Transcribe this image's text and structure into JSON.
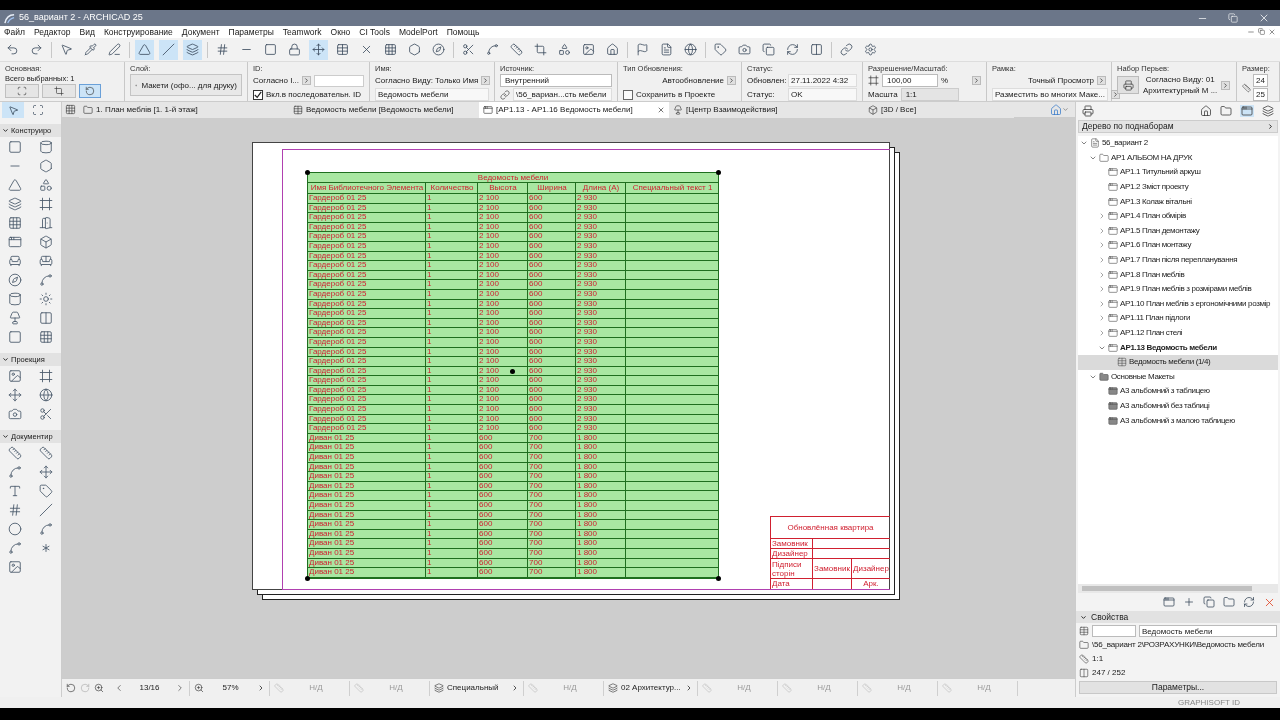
{
  "window": {
    "title": "56_вариант 2 - ARCHICAD 25"
  },
  "menu": [
    "Файл",
    "Редактор",
    "Вид",
    "Конструирование",
    "Документ",
    "Параметры",
    "Teamwork",
    "Окно",
    "CI Tools",
    "ModelPort",
    "Помощь"
  ],
  "info_box": [
    {
      "kind": "basic",
      "label": "Основная:",
      "text": "Всего выбранных: 1"
    },
    {
      "kind": "layer",
      "label": "Слой:",
      "value": "Макети (офо... для друку)"
    },
    {
      "kind": "id",
      "label": "ID:",
      "value": "Согласно I...",
      "checkbox": {
        "label": "Вкл.в последовательн. ID",
        "checked": true
      }
    },
    {
      "kind": "name",
      "label": "Имя:",
      "value": "Согласно Виду: Только Имя",
      "value2": "Ведомость мебели"
    },
    {
      "kind": "source",
      "label": "Источник:",
      "value": "Внутренний",
      "value2": "\\56_вариан...сть мебели"
    },
    {
      "kind": "update",
      "label": "Тип Обновления:",
      "value": "Автообновление",
      "checkbox": {
        "label": "Сохранить в Проекте",
        "checked": false
      }
    },
    {
      "kind": "status",
      "label": "Статус:",
      "rows": [
        {
          "label": "Обновлен:",
          "value": "27.11.2022 4:32"
        },
        {
          "label": "Статус:",
          "value": "OK"
        }
      ]
    },
    {
      "kind": "scale",
      "label": "Разрешение/Масштаб:",
      "value": "100,00",
      "unit": "%",
      "row_label": "Масшта",
      "value2": "1:1"
    },
    {
      "kind": "frame",
      "label": "Рамка:",
      "value": "Точный Просмотр",
      "value2": "Разместить во многих Маке..."
    },
    {
      "kind": "pens",
      "label": "Набор Перьев:",
      "value": "Согласно Виду: 01",
      "value2": "Архитектурный М ..."
    },
    {
      "kind": "size",
      "label": "Размер:",
      "value": "24",
      "value2": "25"
    }
  ],
  "tabs": [
    {
      "kind": "plan",
      "label": "1. План меблів [1. 1-й этаж]",
      "selected": false
    },
    {
      "kind": "schedule",
      "label": "Ведомость мебели [Ведомость мебели]",
      "selected": false
    },
    {
      "kind": "layout",
      "label": "[АР1.13 - АР1.16 Ведомость мебели]",
      "selected": true
    },
    {
      "kind": "web",
      "label": "[Центр Взаимодействия]",
      "selected": false
    },
    {
      "kind": "model",
      "label": "[3D / Все]",
      "selected": false
    }
  ],
  "toolbox": [
    {
      "title": "Конструиро",
      "expanded": true
    },
    {
      "title": "Проекция",
      "expanded": true
    },
    {
      "title": "Документир",
      "expanded": true
    }
  ],
  "table": {
    "title": "Ведомость мебели",
    "columns": [
      "Имя Библиотечного Элемента",
      "Количество",
      "Высота",
      "Ширина",
      "Длина (A)",
      "Специальный текст 1"
    ],
    "rows": [
      [
        "Гардероб 01 25",
        "1",
        "2 100",
        "600",
        "2 930"
      ],
      [
        "Гардероб 01 25",
        "1",
        "2 100",
        "600",
        "2 930"
      ],
      [
        "Гардероб 01 25",
        "1",
        "2 100",
        "600",
        "2 930"
      ],
      [
        "Гардероб 01 25",
        "1",
        "2 100",
        "600",
        "2 930"
      ],
      [
        "Гардероб 01 25",
        "1",
        "2 100",
        "600",
        "2 930"
      ],
      [
        "Гардероб 01 25",
        "1",
        "2 100",
        "600",
        "2 930"
      ],
      [
        "Гардероб 01 25",
        "1",
        "2 100",
        "600",
        "2 930"
      ],
      [
        "Гардероб 01 25",
        "1",
        "2 100",
        "600",
        "2 930"
      ],
      [
        "Гардероб 01 25",
        "1",
        "2 100",
        "600",
        "2 930"
      ],
      [
        "Гардероб 01 25",
        "1",
        "2 100",
        "600",
        "2 930"
      ],
      [
        "Гардероб 01 25",
        "1",
        "2 100",
        "600",
        "2 930"
      ],
      [
        "Гардероб 01 25",
        "1",
        "2 100",
        "600",
        "2 930"
      ],
      [
        "Гардероб 01 25",
        "1",
        "2 100",
        "600",
        "2 930"
      ],
      [
        "Гардероб 01 25",
        "1",
        "2 100",
        "600",
        "2 930"
      ],
      [
        "Гардероб 01 25",
        "1",
        "2 100",
        "600",
        "2 930"
      ],
      [
        "Гардероб 01 25",
        "1",
        "2 100",
        "600",
        "2 930"
      ],
      [
        "Гардероб 01 25",
        "1",
        "2 100",
        "600",
        "2 930"
      ],
      [
        "Гардероб 01 25",
        "1",
        "2 100",
        "600",
        "2 930"
      ],
      [
        "Гардероб 01 25",
        "1",
        "2 100",
        "600",
        "2 930"
      ],
      [
        "Гардероб 01 25",
        "1",
        "2 100",
        "600",
        "2 930"
      ],
      [
        "Гардероб 01 25",
        "1",
        "2 100",
        "600",
        "2 930"
      ],
      [
        "Гардероб 01 25",
        "1",
        "2 100",
        "600",
        "2 930"
      ],
      [
        "Гардероб 01 25",
        "1",
        "2 100",
        "600",
        "2 930"
      ],
      [
        "Гардероб 01 25",
        "1",
        "2 100",
        "600",
        "2 930"
      ],
      [
        "Гардероб 01 25",
        "1",
        "2 100",
        "600",
        "2 930"
      ],
      [
        "Диван 01 25",
        "1",
        "600",
        "700",
        "1 800"
      ],
      [
        "Диван 01 25",
        "1",
        "600",
        "700",
        "1 800"
      ],
      [
        "Диван 01 25",
        "1",
        "600",
        "700",
        "1 800"
      ],
      [
        "Диван 01 25",
        "1",
        "600",
        "700",
        "1 800"
      ],
      [
        "Диван 01 25",
        "1",
        "600",
        "700",
        "1 800"
      ],
      [
        "Диван 01 25",
        "1",
        "600",
        "700",
        "1 800"
      ],
      [
        "Диван 01 25",
        "1",
        "600",
        "700",
        "1 800"
      ],
      [
        "Диван 01 25",
        "1",
        "600",
        "700",
        "1 800"
      ],
      [
        "Диван 01 25",
        "1",
        "600",
        "700",
        "1 800"
      ],
      [
        "Диван 01 25",
        "1",
        "600",
        "700",
        "1 800"
      ],
      [
        "Диван 01 25",
        "1",
        "600",
        "700",
        "1 800"
      ],
      [
        "Диван 01 25",
        "1",
        "600",
        "700",
        "1 800"
      ],
      [
        "Диван 01 25",
        "1",
        "600",
        "700",
        "1 800"
      ],
      [
        "Диван 01 25",
        "1",
        "600",
        "700",
        "1 800"
      ],
      [
        "Диван 01 25",
        "1",
        "600",
        "700",
        "1 800"
      ]
    ]
  },
  "title_block": {
    "title": "Обновлённая квартира",
    "rows": [
      "Замовник",
      "Дизайнер"
    ],
    "signatures": {
      "label": "Підписи сторін",
      "parties": [
        "Замовник",
        "Дизайнер"
      ]
    },
    "date_label": "Дата",
    "sheet_label": "Арк."
  },
  "navigator": {
    "view": "Дерево по поднаборам",
    "tree": [
      {
        "kind": "project",
        "label": "56_вариант 2",
        "expanded": true,
        "selected": false,
        "children": [
          {
            "kind": "folder",
            "label": "АР1 АЛЬБОМ НА ДРУК",
            "expanded": true,
            "selected": false,
            "children": [
              {
                "kind": "layout",
                "label": "АР1.1 Титульний аркуш",
                "selected": false
              },
              {
                "kind": "layout",
                "label": "АР1.2 Зміст проекту",
                "selected": false
              },
              {
                "kind": "layout",
                "label": "АР1.3 Колаж вітальні",
                "selected": false
              },
              {
                "kind": "layout",
                "label": "АР1.4 План обмірів",
                "expanded": false,
                "selected": false
              },
              {
                "kind": "layout",
                "label": "АР1.5 План демонтажу",
                "expanded": false,
                "selected": false
              },
              {
                "kind": "layout",
                "label": "АР1.6 План монтажу",
                "expanded": false,
                "selected": false
              },
              {
                "kind": "layout",
                "label": "АР1.7 План після перепланування",
                "expanded": false,
                "selected": false
              },
              {
                "kind": "layout",
                "label": "АР1.8 План меблів",
                "expanded": false,
                "selected": false
              },
              {
                "kind": "layout",
                "label": "АР1.9 План меблів з розмірами меблів",
                "expanded": false,
                "selected": false
              },
              {
                "kind": "layout",
                "label": "АР1.10 План меблів з ергономічними розмір",
                "expanded": false,
                "selected": false
              },
              {
                "kind": "layout",
                "label": "АР1.11 План підлоги",
                "expanded": false,
                "selected": false
              },
              {
                "kind": "layout",
                "label": "АР1.12 План стелі",
                "expanded": false,
                "selected": false
              },
              {
                "kind": "layout",
                "label": "АР1.13 Ведомость мебели",
                "expanded": true,
                "current": true,
                "selected": false,
                "children": [
                  {
                    "kind": "schedule",
                    "label": "Ведомость мебели (1/4)",
                    "selected": true
                  }
                ]
              }
            ]
          },
          {
            "kind": "master_folder",
            "label": "Основные Макеты",
            "expanded": true,
            "selected": false,
            "children": [
              {
                "kind": "master",
                "label": "А3 альбомний з таблицею",
                "selected": false
              },
              {
                "kind": "master",
                "label": "А3 альбомний без таблиці",
                "selected": false
              },
              {
                "kind": "master",
                "label": "А3 альбомний з малою таблицею",
                "selected": false
              }
            ]
          }
        ]
      }
    ]
  },
  "properties": {
    "title": "Свойства",
    "expanded": true,
    "name": "Ведомость мебели",
    "path": "\\56_вариант 2\\РОЗРАХУНКИ\\Ведомость мебели",
    "scale": "1:1",
    "pens": "247 / 252",
    "button": "Параметры..."
  },
  "status_bar": [
    {
      "kind": "pages",
      "value": "13/16"
    },
    {
      "kind": "zoom",
      "value": "57%"
    },
    {
      "kind": "na",
      "value": "Н/Д"
    },
    {
      "kind": "na",
      "value": "Н/Д"
    },
    {
      "kind": "dropdown",
      "value": "Специальный"
    },
    {
      "kind": "na",
      "value": "Н/Д"
    },
    {
      "kind": "dropdown",
      "value": "02 Архитектур..."
    },
    {
      "kind": "na",
      "value": "Н/Д"
    },
    {
      "kind": "na",
      "value": "Н/Д"
    },
    {
      "kind": "na",
      "value": "Н/Д"
    },
    {
      "kind": "na",
      "value": "Н/Д"
    }
  ],
  "account_label": "GRAPHISOFT ID"
}
